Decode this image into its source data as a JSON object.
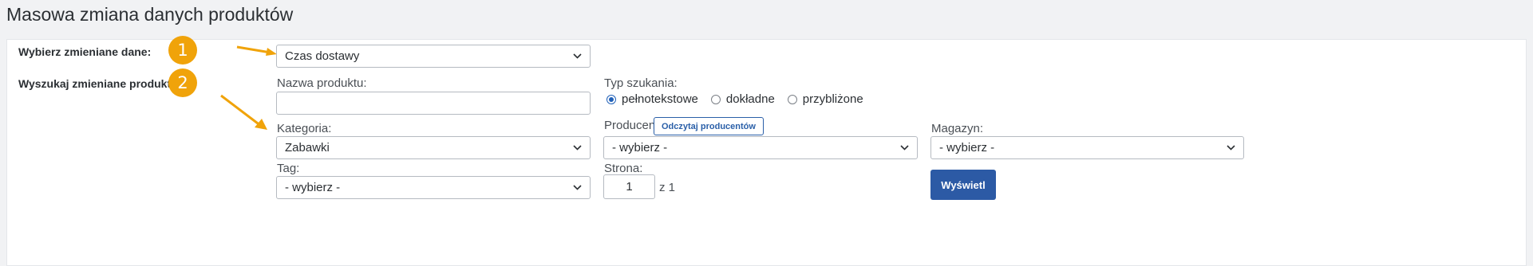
{
  "page": {
    "title": "Masowa zmiana danych produktów"
  },
  "step1": {
    "label": "Wybierz zmieniane dane:",
    "badge": "1",
    "select_value": "Czas dostawy"
  },
  "step2": {
    "label": "Wyszukaj zmieniane produkty:",
    "badge": "2"
  },
  "search": {
    "product_name_label": "Nazwa produktu:",
    "product_name_value": "",
    "search_type_label": "Typ szukania:",
    "search_types": [
      {
        "label": "pełnotekstowe",
        "checked": true
      },
      {
        "label": "dokładne",
        "checked": false
      },
      {
        "label": "przybliżone",
        "checked": false
      }
    ],
    "category_label": "Kategoria:",
    "category_value": "Zabawki",
    "producer_label": "Producent:",
    "read_producers_button": "Odczytaj producentów",
    "producer_value": "- wybierz -",
    "warehouse_label": "Magazyn:",
    "warehouse_value": "- wybierz -",
    "tag_label": "Tag:",
    "tag_value": "- wybierz -",
    "page_label": "Strona:",
    "page_value": "1",
    "page_of": "z 1",
    "show_button": "Wyświetl"
  },
  "colors": {
    "accent": "#f0a30a",
    "primary": "#2c5aa5",
    "radio": "#2060b8"
  },
  "icons": {
    "dropdown": "chevron-down-icon",
    "arrow": "arrow-pointer-icon"
  }
}
